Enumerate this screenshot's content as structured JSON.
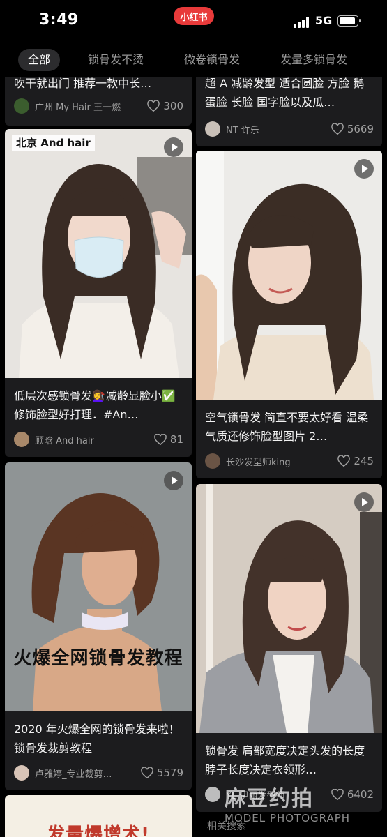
{
  "status": {
    "time": "3:49",
    "app_badge": "小红书",
    "network": "5G"
  },
  "tabs": [
    {
      "label": "全部",
      "active": true
    },
    {
      "label": "锁骨发不烫",
      "active": false
    },
    {
      "label": "微卷锁骨发",
      "active": false
    },
    {
      "label": "发量多锁骨发",
      "active": false
    }
  ],
  "cards": [
    {
      "title": "吹干就出门 推荐一款中长…",
      "author": "广州 My Hair 王一燃",
      "likes": "300"
    },
    {
      "title": "超 A 减龄发型 适合圆脸 方脸 鹅蛋脸 长脸 国字脸以及瓜…",
      "author": "NT 许乐",
      "likes": "5669"
    },
    {
      "tag": "北京 And hair",
      "title": "低层次感锁骨发💇‍♀️减龄显脸小✅修饰脸型好打理．#An…",
      "author": "顾晗 And hair",
      "likes": "81"
    },
    {
      "title": "空气锁骨发 简直不要太好看 温柔气质还修饰脸型图片 2…",
      "author": "长沙发型师king",
      "likes": "245"
    },
    {
      "overlay": "火爆全网锁骨发教程",
      "title": "2020 年火爆全网的锁骨发来啦！ 锁骨发裁剪教程",
      "author": "卢雅婷_专业裁剪…",
      "likes": "5579"
    },
    {
      "title": "锁骨发 肩部宽度决定头发的长度 脖子长度决定衣领形…",
      "author": "YL 伊丽发型师",
      "likes": "6402"
    },
    {
      "overlay": "发量爆增术!"
    }
  ],
  "bottom_hint": "相关搜索",
  "watermark": {
    "main": "麻豆约拍",
    "sub": "MODEL PHOTOGRAPH"
  },
  "colors": {
    "background": "#000000",
    "card": "#1c1c1e",
    "accent": "#e83a3a",
    "muted": "#a0a0a0"
  },
  "icons": {
    "like": "heart-outline-icon",
    "play": "play-icon",
    "signal": "cellular-signal-icon",
    "battery": "battery-icon"
  }
}
